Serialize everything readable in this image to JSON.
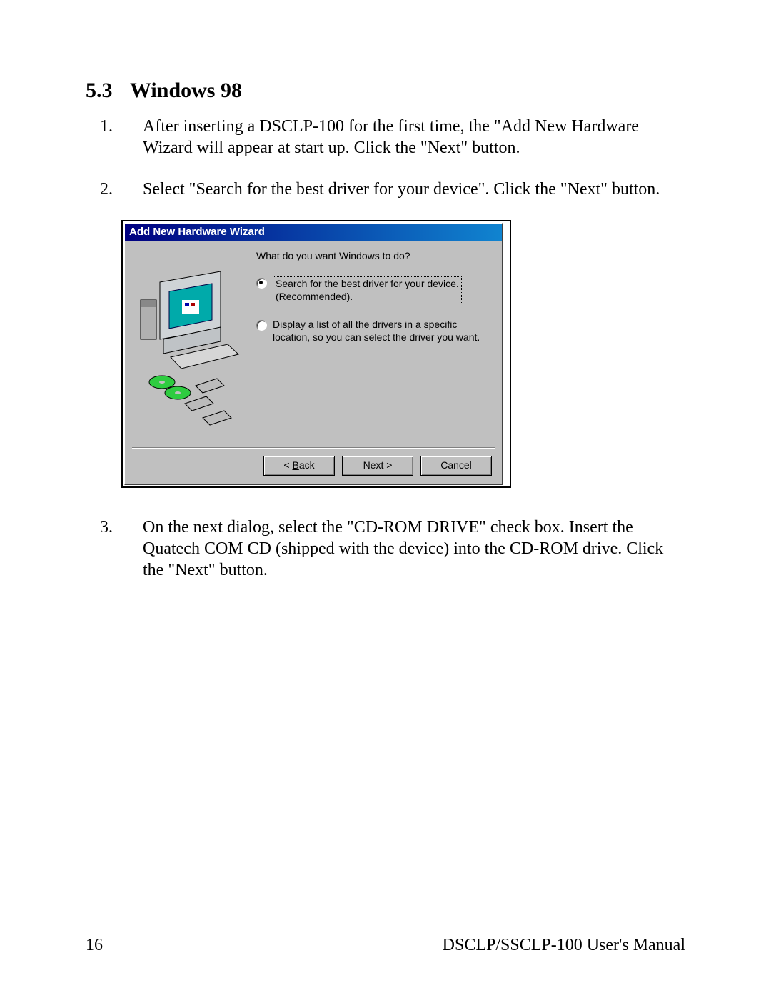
{
  "section": {
    "number": "5.3",
    "title": "Windows 98"
  },
  "steps": [
    {
      "n": "1.",
      "text": "After inserting a DSCLP-100 for the first time, the \"Add New Hardware Wizard will appear at start up. Click the \"Next\" button."
    },
    {
      "n": "2.",
      "text": "Select \"Search for the best driver for your device\". Click the \"Next\" button."
    },
    {
      "n": "3.",
      "text": "On the next dialog, select the \"CD-ROM DRIVE\" check box. Insert the Quatech COM CD (shipped with the device) into the CD-ROM drive. Click the \"Next\" button."
    }
  ],
  "dialog": {
    "title": "Add New Hardware Wizard",
    "prompt": "What do you want Windows to do?",
    "opt1a": "Search for the best driver for your device.",
    "opt1b": "(Recommended).",
    "opt2": "Display a list of all the drivers in a specific location, so you can select the driver you want.",
    "back_u": "B",
    "back_rest": "ack",
    "next": "Next >",
    "cancel": "Cancel"
  },
  "footer": {
    "page": "16",
    "doc": "DSCLP/SSCLP-100 User's Manual"
  }
}
